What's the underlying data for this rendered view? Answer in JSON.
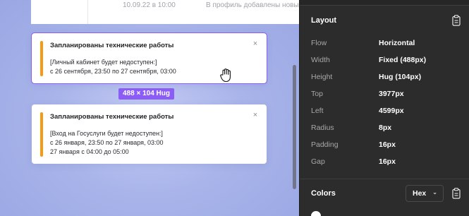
{
  "canvas": {
    "top_card": {
      "date": "10.09.22 в 10:00",
      "text": "В профиль добавлены новые"
    },
    "notifications": [
      {
        "title": "Запланированы технические работы",
        "lines": [
          "[Личный кабинет будет недоступен:]",
          "с 26 сентября, 23:50 по 27 сентября, 03:00"
        ],
        "close_icon": "×",
        "selected": true
      },
      {
        "title": "Запланированы технические работы",
        "lines": [
          "[Вход на Госуслуги будет недоступен:]",
          "с 26 января, 23:50 по 27 января, 03:00",
          "27 января с 04:00 до 05:00"
        ],
        "close_icon": "×",
        "selected": false
      }
    ],
    "size_badge": "488 × 104 Hug",
    "cursor_icon": "grab-hand-icon",
    "accent_color": "#f59a12",
    "selection_color": "#8b5cf6"
  },
  "panel": {
    "layout_title": "Layout",
    "properties": [
      {
        "label": "Flow",
        "value": "Horizontal"
      },
      {
        "label": "Width",
        "value": "Fixed (488px)"
      },
      {
        "label": "Height",
        "value": "Hug (104px)"
      },
      {
        "label": "Top",
        "value": "3977px"
      },
      {
        "label": "Left",
        "value": "4599px"
      },
      {
        "label": "Radius",
        "value": "8px"
      },
      {
        "label": "Padding",
        "value": "16px"
      },
      {
        "label": "Gap",
        "value": "16px"
      }
    ],
    "colors_title": "Colors",
    "color_format": "Hex",
    "copy_icon": "clipboard-icon"
  }
}
